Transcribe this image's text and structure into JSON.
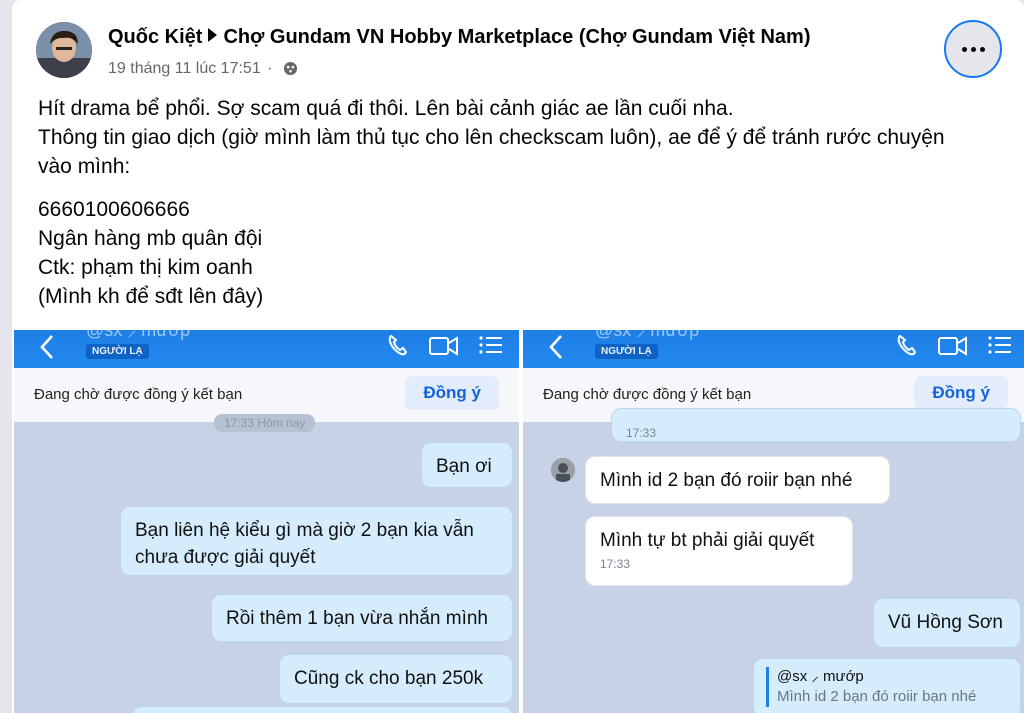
{
  "post": {
    "author": "Quốc Kiệt",
    "group": "Chợ Gundam VN Hobby Marketplace (Chợ Gundam Việt Nam)",
    "date": "19 tháng 11 lúc 17:51",
    "separator": "·",
    "lines": [
      "Hít drama bể phổi. Sợ scam quá đi thôi. Lên bài cảnh giác ae lần cuối nha.",
      "Thông tin giao dịch (giờ mình làm thủ tục cho lên checkscam luôn), ae để ý để tránh rước chuyện",
      "vào mình:"
    ],
    "details": [
      "6660100606666",
      "Ngân hàng mb quân đội",
      "Ctk: phạm thị kim oanh",
      "(Mình kh để sđt lên đây)"
    ]
  },
  "left_shot": {
    "header_ghost": "@sx ⸝ mướp",
    "stranger_tag": "NGƯỜI LẠ",
    "pending_text": "Đang chờ được đồng ý kết bạn",
    "accept_label": "Đồng ý",
    "top_time": "17:33 Hôm nay",
    "messages": [
      "Bạn ơi",
      "Bạn liên hệ kiểu gì mà giờ 2 bạn kia vẫn chưa được giải quyết",
      "Rồi thêm 1 bạn vừa nhắn mình",
      "Cũng ck cho bạn 250k"
    ]
  },
  "right_shot": {
    "header_ghost": "@sx ⸝ mướp",
    "stranger_tag": "NGƯỜI LẠ",
    "pending_text": "Đang chờ được đồng ý kết bạn",
    "accept_label": "Đồng ý",
    "prev_time": "17:33",
    "in_messages": [
      "Mình id 2 bạn đó roiir bạn nhé",
      "Mình tự bt phải giải quyết"
    ],
    "in_time": "17:33",
    "out_message": "Vũ Hồng Sơn",
    "quote_name": "@sx ⸝ mướp",
    "quote_text": "Mình id 2 bạn đó roiir bạn nhé"
  },
  "colors": {
    "zalo_blue": "#1e7fe6",
    "accept_text": "#1463d8",
    "out_bubble": "#d5ecfc",
    "chat_bg": "#c8d2e6"
  },
  "icons": [
    "profile-avatar",
    "globe-icon",
    "more-icon",
    "back-arrow-icon",
    "phone-icon",
    "video-icon",
    "list-icon"
  ]
}
